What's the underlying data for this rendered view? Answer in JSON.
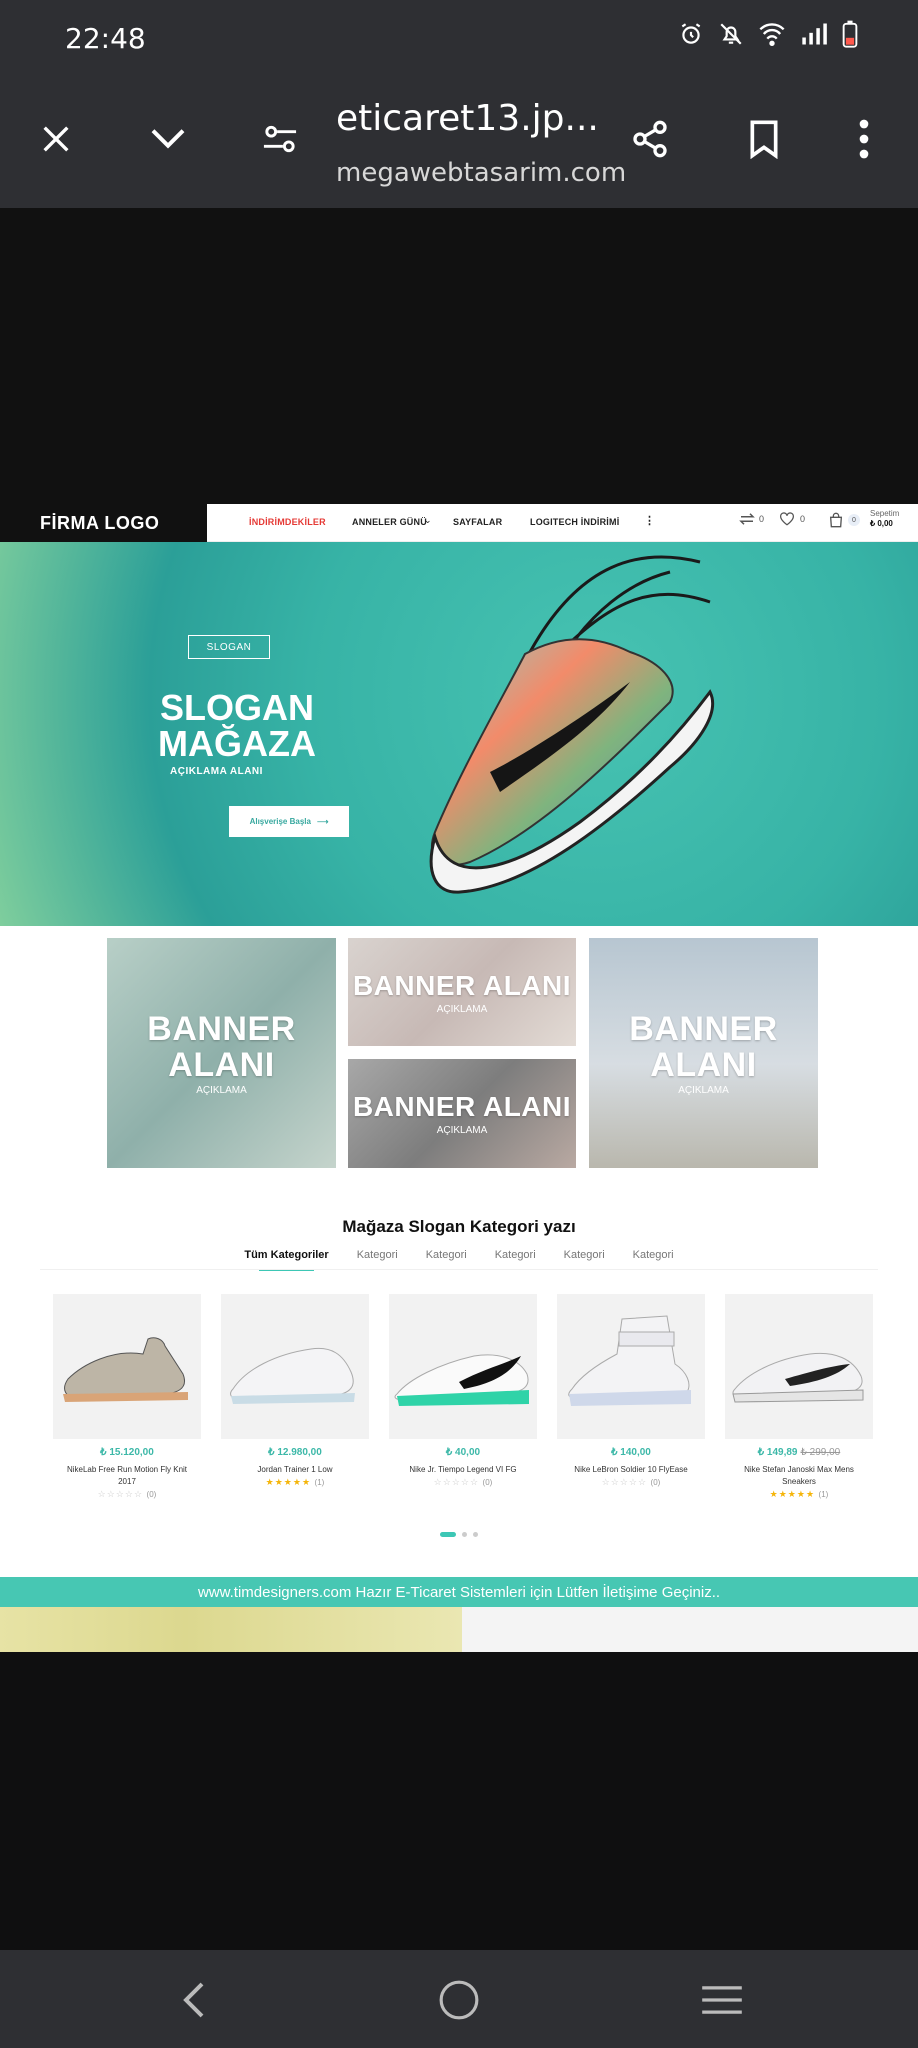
{
  "status_bar": {
    "time": "22:48"
  },
  "browser": {
    "title": "eticaret13.jp...",
    "domain": "megawebtasarim.com"
  },
  "site": {
    "logo": "FİRMA LOGO",
    "nav": [
      "İNDİRİMDEKİLER",
      "ANNELER GÜNÜ",
      "SAYFALAR",
      "LOGITECH İNDİRİMİ"
    ],
    "nav_more": "⋮",
    "compare_count": "0",
    "wishlist_count": "0",
    "cart_count": "0",
    "cart_label": "Sepetim",
    "cart_total": "₺ 0,00"
  },
  "hero": {
    "slogan_tag": "SLOGAN",
    "title_line1": "SLOGAN",
    "title_line2": "MAĞAZA",
    "description": "AÇIKLAMA ALANI",
    "button": "Alışverişe Başla"
  },
  "banners": [
    {
      "title_line1": "BANNER",
      "title_line2": "ALANI",
      "desc": "AÇIKLAMA"
    },
    {
      "title_line1": "BANNER ALANI",
      "title_line2": "",
      "desc": "AÇIKLAMA"
    },
    {
      "title_line1": "BANNER ALANI",
      "title_line2": "",
      "desc": "AÇIKLAMA"
    },
    {
      "title_line1": "BANNER",
      "title_line2": "ALANI",
      "desc": "AÇIKLAMA"
    }
  ],
  "category": {
    "title": "Mağaza Slogan Kategori yazı",
    "tabs": [
      "Tüm Kategoriler",
      "Kategori",
      "Kategori",
      "Kategori",
      "Kategori",
      "Kategori"
    ]
  },
  "products": [
    {
      "price": "₺ 15.120,00",
      "old_price": "",
      "name": "NikeLab Free Run Motion Fly Knit 2017",
      "stars": "☆☆☆☆☆",
      "reviews": "(0)"
    },
    {
      "price": "₺ 12.980,00",
      "old_price": "",
      "name": "Jordan Trainer 1 Low",
      "stars": "★★★★★",
      "reviews": "(1)"
    },
    {
      "price": "₺ 40,00",
      "old_price": "",
      "name": "Nike Jr. Tiempo Legend VI FG",
      "stars": "☆☆☆☆☆",
      "reviews": "(0)"
    },
    {
      "price": "₺ 140,00",
      "old_price": "",
      "name": "Nike LeBron Soldier 10 FlyEase",
      "stars": "☆☆☆☆☆",
      "reviews": "(0)"
    },
    {
      "price": "₺ 149,89",
      "old_price": "₺ 299,00",
      "name": "Nike Stefan Janoski Max Mens Sneakers",
      "stars": "★★★★★",
      "reviews": "(1)"
    }
  ],
  "notice": "www.timdesigners.com Hazır E-Ticaret Sistemleri için Lütfen İletişime Geçiniz..",
  "colors": {
    "accent": "#47c7b3",
    "sale_red": "#e53935",
    "star": "#f5b50a"
  }
}
